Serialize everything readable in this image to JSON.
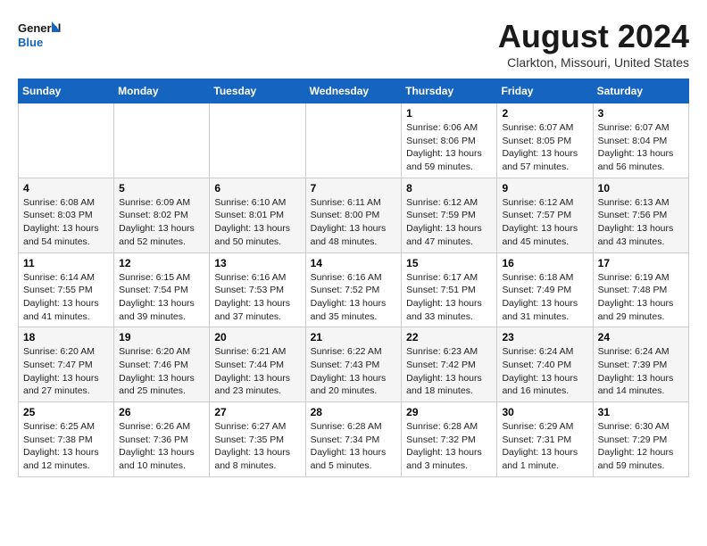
{
  "header": {
    "logo_line1": "General",
    "logo_line2": "Blue",
    "month_title": "August 2024",
    "location": "Clarkton, Missouri, United States"
  },
  "weekdays": [
    "Sunday",
    "Monday",
    "Tuesday",
    "Wednesday",
    "Thursday",
    "Friday",
    "Saturday"
  ],
  "weeks": [
    [
      {
        "day": "",
        "info": ""
      },
      {
        "day": "",
        "info": ""
      },
      {
        "day": "",
        "info": ""
      },
      {
        "day": "",
        "info": ""
      },
      {
        "day": "1",
        "info": "Sunrise: 6:06 AM\nSunset: 8:06 PM\nDaylight: 13 hours\nand 59 minutes."
      },
      {
        "day": "2",
        "info": "Sunrise: 6:07 AM\nSunset: 8:05 PM\nDaylight: 13 hours\nand 57 minutes."
      },
      {
        "day": "3",
        "info": "Sunrise: 6:07 AM\nSunset: 8:04 PM\nDaylight: 13 hours\nand 56 minutes."
      }
    ],
    [
      {
        "day": "4",
        "info": "Sunrise: 6:08 AM\nSunset: 8:03 PM\nDaylight: 13 hours\nand 54 minutes."
      },
      {
        "day": "5",
        "info": "Sunrise: 6:09 AM\nSunset: 8:02 PM\nDaylight: 13 hours\nand 52 minutes."
      },
      {
        "day": "6",
        "info": "Sunrise: 6:10 AM\nSunset: 8:01 PM\nDaylight: 13 hours\nand 50 minutes."
      },
      {
        "day": "7",
        "info": "Sunrise: 6:11 AM\nSunset: 8:00 PM\nDaylight: 13 hours\nand 48 minutes."
      },
      {
        "day": "8",
        "info": "Sunrise: 6:12 AM\nSunset: 7:59 PM\nDaylight: 13 hours\nand 47 minutes."
      },
      {
        "day": "9",
        "info": "Sunrise: 6:12 AM\nSunset: 7:57 PM\nDaylight: 13 hours\nand 45 minutes."
      },
      {
        "day": "10",
        "info": "Sunrise: 6:13 AM\nSunset: 7:56 PM\nDaylight: 13 hours\nand 43 minutes."
      }
    ],
    [
      {
        "day": "11",
        "info": "Sunrise: 6:14 AM\nSunset: 7:55 PM\nDaylight: 13 hours\nand 41 minutes."
      },
      {
        "day": "12",
        "info": "Sunrise: 6:15 AM\nSunset: 7:54 PM\nDaylight: 13 hours\nand 39 minutes."
      },
      {
        "day": "13",
        "info": "Sunrise: 6:16 AM\nSunset: 7:53 PM\nDaylight: 13 hours\nand 37 minutes."
      },
      {
        "day": "14",
        "info": "Sunrise: 6:16 AM\nSunset: 7:52 PM\nDaylight: 13 hours\nand 35 minutes."
      },
      {
        "day": "15",
        "info": "Sunrise: 6:17 AM\nSunset: 7:51 PM\nDaylight: 13 hours\nand 33 minutes."
      },
      {
        "day": "16",
        "info": "Sunrise: 6:18 AM\nSunset: 7:49 PM\nDaylight: 13 hours\nand 31 minutes."
      },
      {
        "day": "17",
        "info": "Sunrise: 6:19 AM\nSunset: 7:48 PM\nDaylight: 13 hours\nand 29 minutes."
      }
    ],
    [
      {
        "day": "18",
        "info": "Sunrise: 6:20 AM\nSunset: 7:47 PM\nDaylight: 13 hours\nand 27 minutes."
      },
      {
        "day": "19",
        "info": "Sunrise: 6:20 AM\nSunset: 7:46 PM\nDaylight: 13 hours\nand 25 minutes."
      },
      {
        "day": "20",
        "info": "Sunrise: 6:21 AM\nSunset: 7:44 PM\nDaylight: 13 hours\nand 23 minutes."
      },
      {
        "day": "21",
        "info": "Sunrise: 6:22 AM\nSunset: 7:43 PM\nDaylight: 13 hours\nand 20 minutes."
      },
      {
        "day": "22",
        "info": "Sunrise: 6:23 AM\nSunset: 7:42 PM\nDaylight: 13 hours\nand 18 minutes."
      },
      {
        "day": "23",
        "info": "Sunrise: 6:24 AM\nSunset: 7:40 PM\nDaylight: 13 hours\nand 16 minutes."
      },
      {
        "day": "24",
        "info": "Sunrise: 6:24 AM\nSunset: 7:39 PM\nDaylight: 13 hours\nand 14 minutes."
      }
    ],
    [
      {
        "day": "25",
        "info": "Sunrise: 6:25 AM\nSunset: 7:38 PM\nDaylight: 13 hours\nand 12 minutes."
      },
      {
        "day": "26",
        "info": "Sunrise: 6:26 AM\nSunset: 7:36 PM\nDaylight: 13 hours\nand 10 minutes."
      },
      {
        "day": "27",
        "info": "Sunrise: 6:27 AM\nSunset: 7:35 PM\nDaylight: 13 hours\nand 8 minutes."
      },
      {
        "day": "28",
        "info": "Sunrise: 6:28 AM\nSunset: 7:34 PM\nDaylight: 13 hours\nand 5 minutes."
      },
      {
        "day": "29",
        "info": "Sunrise: 6:28 AM\nSunset: 7:32 PM\nDaylight: 13 hours\nand 3 minutes."
      },
      {
        "day": "30",
        "info": "Sunrise: 6:29 AM\nSunset: 7:31 PM\nDaylight: 13 hours\nand 1 minute."
      },
      {
        "day": "31",
        "info": "Sunrise: 6:30 AM\nSunset: 7:29 PM\nDaylight: 12 hours\nand 59 minutes."
      }
    ]
  ]
}
